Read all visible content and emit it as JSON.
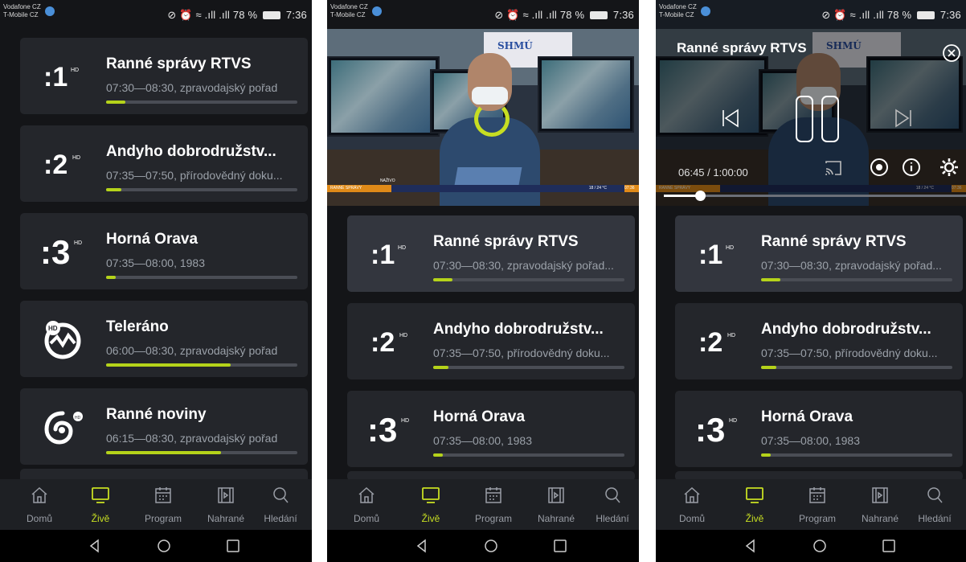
{
  "status_bar": {
    "carrier_1": "Vodafone CZ",
    "carrier_2": "T-Mobile CZ",
    "signal_text": "⊘ ⏰ ≡ .ıll .ıll",
    "battery": "78 %",
    "time": "7:36"
  },
  "channels": [
    {
      "logo": ":1",
      "logo_tag": "HD",
      "title": "Ranné správy RTVS",
      "subtitle": "07:30—08:30, zpravodajský pořad",
      "progress": 0.1
    },
    {
      "logo": ":2",
      "logo_tag": "HD",
      "title": "Andyho dobrodružstv...",
      "subtitle": "07:35—07:50, přírodovědný doku...",
      "progress": 0.08
    },
    {
      "logo": ":3",
      "logo_tag": "HD",
      "title": "Horná Orava",
      "subtitle": "07:35—08:00, 1983",
      "progress": 0.05
    },
    {
      "logo": "HD",
      "logo_tag": "",
      "title": "Teleráno",
      "subtitle": "06:00—08:30, zpravodajský pořad",
      "progress": 0.65
    },
    {
      "logo": "",
      "logo_tag": "HD",
      "title": "Ranné noviny",
      "subtitle": "06:15—08:30, zpravodajský pořad",
      "progress": 0.6
    }
  ],
  "channels_p2": [
    {
      "title": "Ranné správy RTVS",
      "subtitle": "07:30—08:30, zpravodajský pořad...",
      "progress": 0.1
    },
    {
      "title": "Andyho dobrodružstv...",
      "subtitle": "07:35—07:50, přírodovědný doku...",
      "progress": 0.08
    },
    {
      "title": "Horná Orava",
      "subtitle": "07:35—08:00, 1983",
      "progress": 0.05
    }
  ],
  "nav": {
    "items": [
      "Domů",
      "Živě",
      "Program",
      "Nahrané",
      "Hledání"
    ],
    "active_index": 1
  },
  "video": {
    "sign_text": "SHMÚ",
    "live_label": "NAŽIVO",
    "ticker_left": "RANNÉ SPRÁVY",
    "ticker_right": "18 / 24 °C",
    "ticker_time": "07:36"
  },
  "player": {
    "title": "Ranné správy RTVS",
    "time": "06:45 / 1:00:00",
    "progress": 0.12
  },
  "colors": {
    "accent": "#c7de22",
    "background": "#141518",
    "card": "#24262b",
    "card_active": "#33363e"
  }
}
